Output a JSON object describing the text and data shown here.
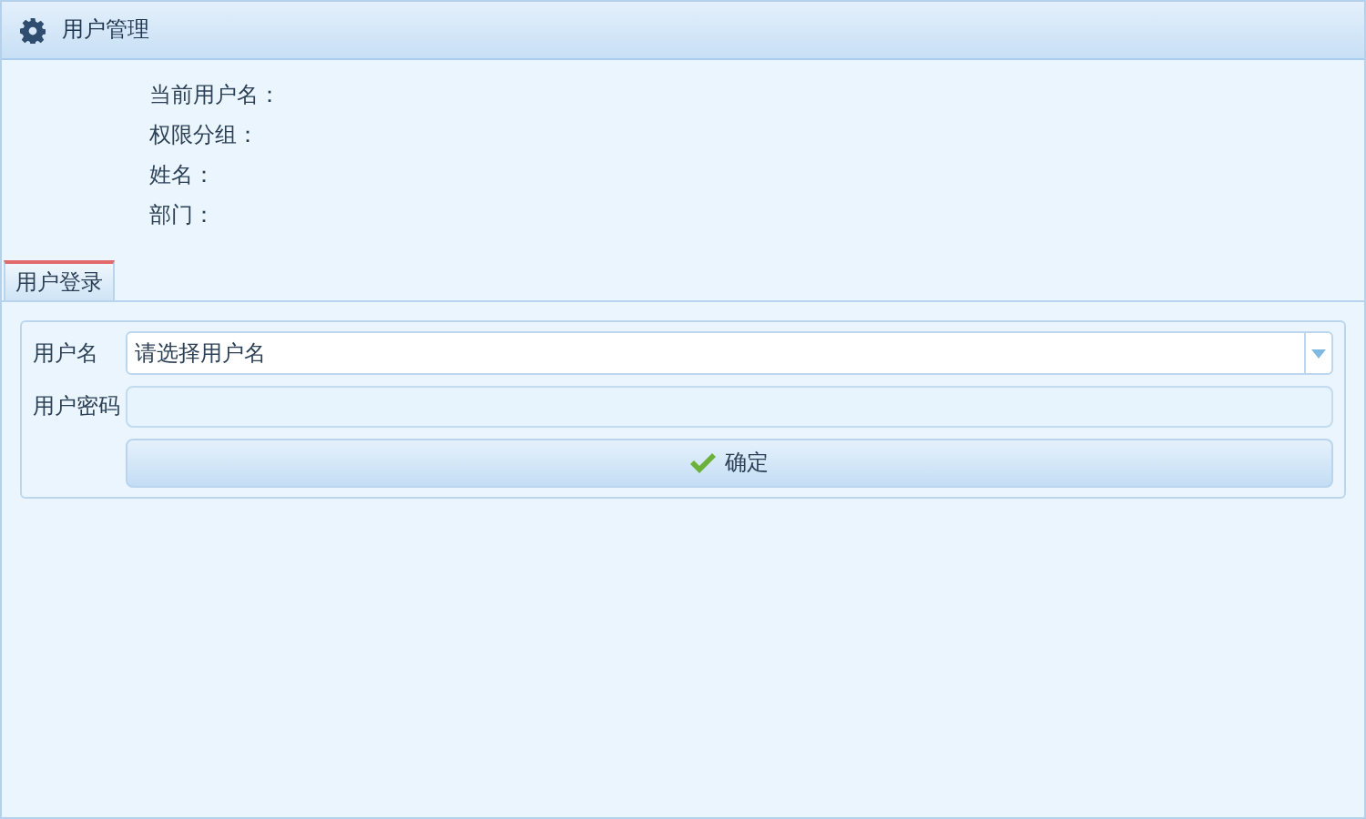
{
  "panel": {
    "title": "用户管理"
  },
  "info_fields": [
    {
      "label": "当前用户名："
    },
    {
      "label": "权限分组："
    },
    {
      "label": "姓名："
    },
    {
      "label": "部门："
    }
  ],
  "tabs": [
    {
      "label": "用户登录",
      "selected": true
    }
  ],
  "form": {
    "username": {
      "label": "用户名",
      "placeholder": "请选择用户名"
    },
    "password": {
      "label": "用户密码"
    },
    "submit": {
      "label": "确定"
    }
  }
}
